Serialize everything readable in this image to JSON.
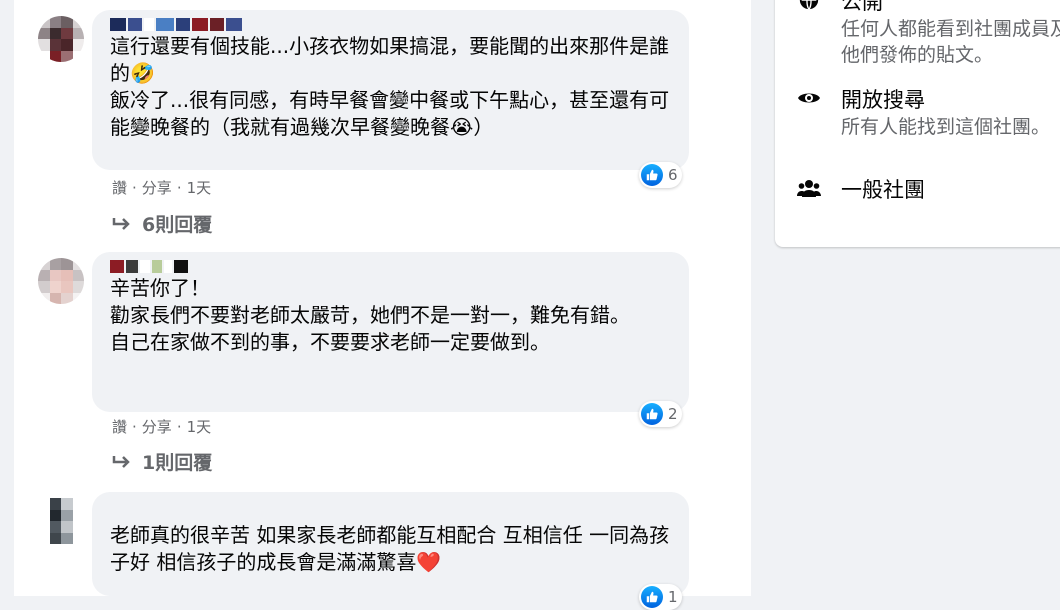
{
  "comments": [
    {
      "text": "這行還要有個技能...小孩衣物如果搞混，要能聞的出來那件是誰的🤣\n飯冷了...很有同感，有時早餐會變中餐或下午點心，甚至還有可能變晚餐的（我就有過幾次早餐變晚餐😭）",
      "reaction_count": "6",
      "actions": {
        "like": "讚",
        "share": "分享",
        "time": "1天"
      },
      "replies_label": "6則回覆"
    },
    {
      "text": "辛苦你了！\n勸家長們不要對老師太嚴苛，她們不是一對一，難免有錯。\n自己在家做不到的事，不要要求老師一定要做到。",
      "reaction_count": "2",
      "actions": {
        "like": "讚",
        "share": "分享",
        "time": "1天"
      },
      "replies_label": "1則回覆"
    },
    {
      "text": "老師真的很辛苦 如果家長老師都能互相配合 互相信任 一同為孩子好 相信孩子的成長會是滿滿驚喜❤️",
      "reaction_count": "1"
    }
  ],
  "group_info": {
    "public": {
      "title": "公開",
      "desc": "任何人都能看到社團成員及他們發佈的貼文。",
      "icon": "globe-icon"
    },
    "visible": {
      "title": "開放搜尋",
      "desc": "所有人能找到這個社團。",
      "icon": "eye-icon"
    },
    "type": {
      "title": "一般社團",
      "icon": "people-icon"
    }
  },
  "colors": {
    "like_blue": "#1877f2",
    "bubble": "#f0f2f5",
    "meta_gray": "#65676b"
  }
}
